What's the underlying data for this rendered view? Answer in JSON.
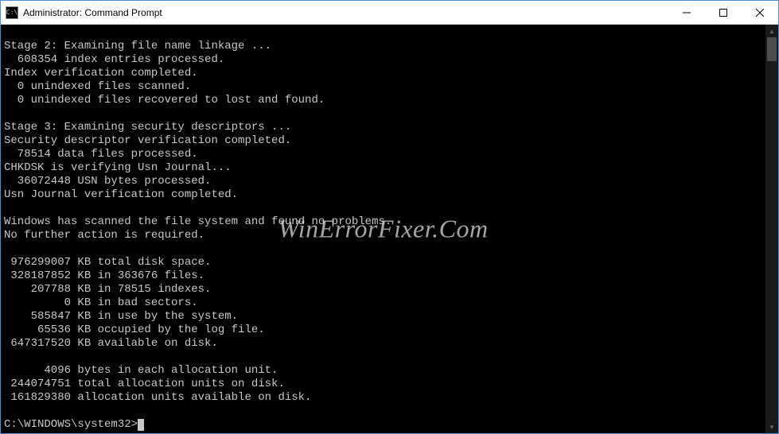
{
  "window": {
    "title": "Administrator: Command Prompt"
  },
  "terminal": {
    "lines": [
      "",
      "Stage 2: Examining file name linkage ...",
      "  608354 index entries processed.",
      "Index verification completed.",
      "  0 unindexed files scanned.",
      "  0 unindexed files recovered to lost and found.",
      "",
      "Stage 3: Examining security descriptors ...",
      "Security descriptor verification completed.",
      "  78514 data files processed.",
      "CHKDSK is verifying Usn Journal...",
      "  36072448 USN bytes processed.",
      "Usn Journal verification completed.",
      "",
      "Windows has scanned the file system and found no problems.",
      "No further action is required.",
      "",
      " 976299007 KB total disk space.",
      " 328187852 KB in 363676 files.",
      "    207788 KB in 78515 indexes.",
      "         0 KB in bad sectors.",
      "    585847 KB in use by the system.",
      "     65536 KB occupied by the log file.",
      " 647317520 KB available on disk.",
      "",
      "      4096 bytes in each allocation unit.",
      " 244074751 total allocation units on disk.",
      " 161829380 allocation units available on disk.",
      ""
    ],
    "prompt": "C:\\WINDOWS\\system32>"
  },
  "watermark": "WinErrorFixer.Com"
}
